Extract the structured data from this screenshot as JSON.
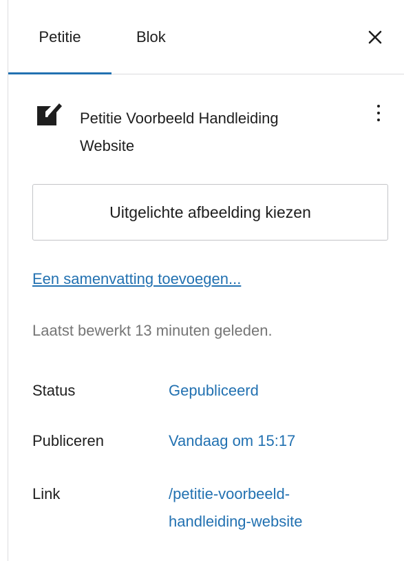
{
  "tabs": [
    {
      "label": "Petitie",
      "active": true
    },
    {
      "label": "Blok",
      "active": false
    }
  ],
  "document": {
    "title": "Petitie Voorbeeld Handleiding Website",
    "icon": "post-edit-icon"
  },
  "featured_image": {
    "button_label": "Uitgelichte afbeelding kiezen"
  },
  "excerpt": {
    "link_label": "Een samenvatting toevoegen..."
  },
  "last_edited": "Laatst bewerkt 13 minuten geleden.",
  "meta": {
    "status": {
      "label": "Status",
      "value": "Gepubliceerd"
    },
    "publish": {
      "label": "Publiceren",
      "value": "Vandaag om 15:17"
    },
    "link": {
      "label": "Link",
      "value_line1": "/petitie-voorbeeld-",
      "value_line2": "handleiding-website"
    }
  },
  "colors": {
    "accent": "#2271b1",
    "text": "#1e1e1e",
    "muted": "#757575",
    "border": "#dcdcde"
  }
}
